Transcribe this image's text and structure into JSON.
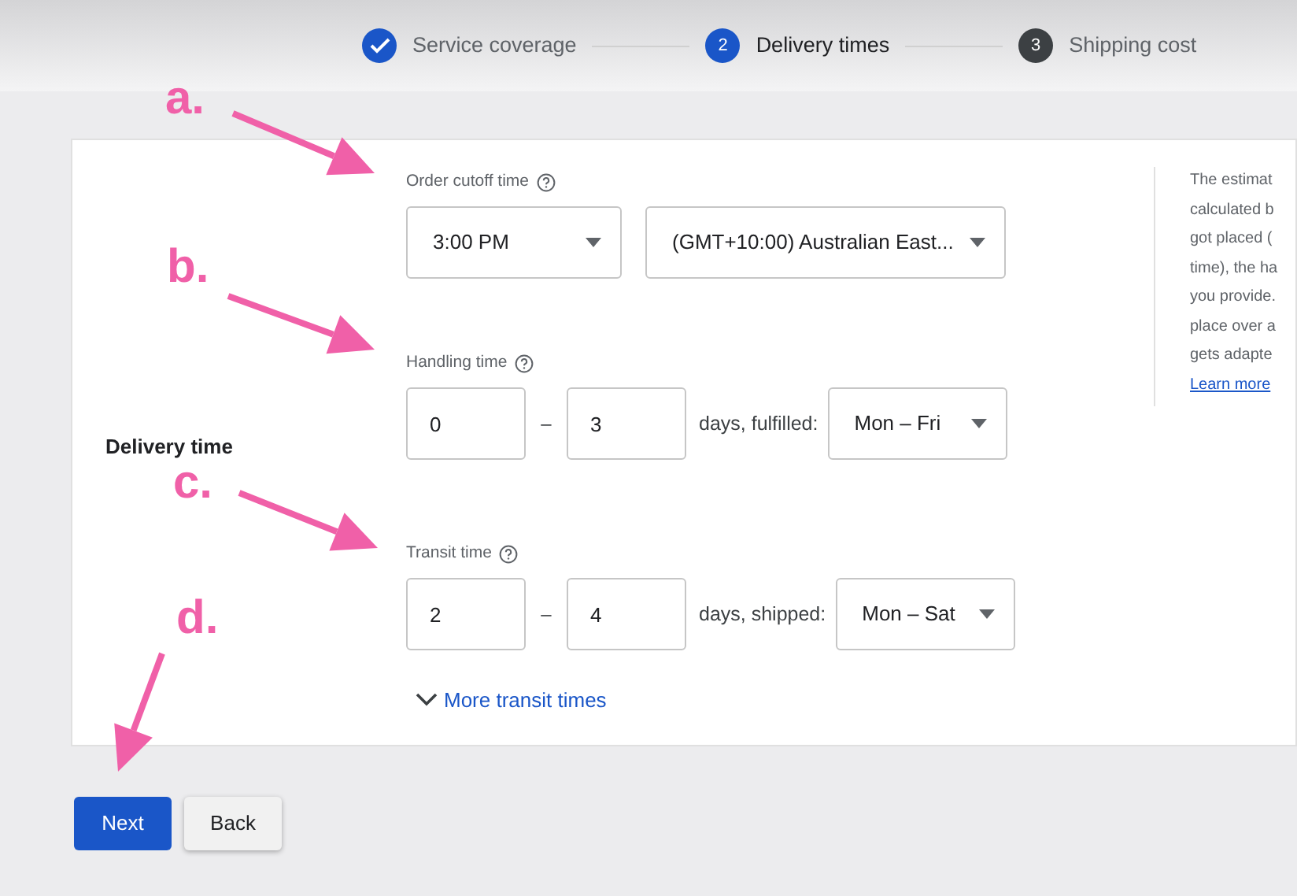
{
  "stepper": [
    {
      "label": "Service coverage",
      "completed": true,
      "selected": false
    },
    {
      "label": "Delivery times",
      "completed": false,
      "selected": true,
      "number": "2"
    },
    {
      "label": "Shipping cost",
      "completed": false,
      "selected": false,
      "number": "3"
    }
  ],
  "section_label": "Delivery time",
  "cutoff": {
    "label": "Order cutoff time",
    "time": "3:00 PM",
    "timezone": "(GMT+10:00) Australian East..."
  },
  "ranges": [
    {
      "label": "Handling time",
      "min": "0",
      "dash": "–",
      "max": "3",
      "suffix": "days, fulfilled:",
      "days": "Mon – Fri"
    },
    {
      "label": "Transit time",
      "min": "2",
      "dash": "–",
      "max": "4",
      "suffix": "days, shipped:",
      "days": "Mon – Sat"
    }
  ],
  "more_link": "More transit times",
  "info_lines": [
    "The estimat",
    "calculated b",
    "got placed (",
    "time), the ha",
    "you provide.",
    "place over a",
    "gets adapte"
  ],
  "info_link": "Learn more",
  "buttons": [
    {
      "label": "Next",
      "kind": "primary"
    },
    {
      "label": "Back",
      "kind": "secondary"
    }
  ],
  "annotations": [
    "a.",
    "b.",
    "c.",
    "d."
  ]
}
